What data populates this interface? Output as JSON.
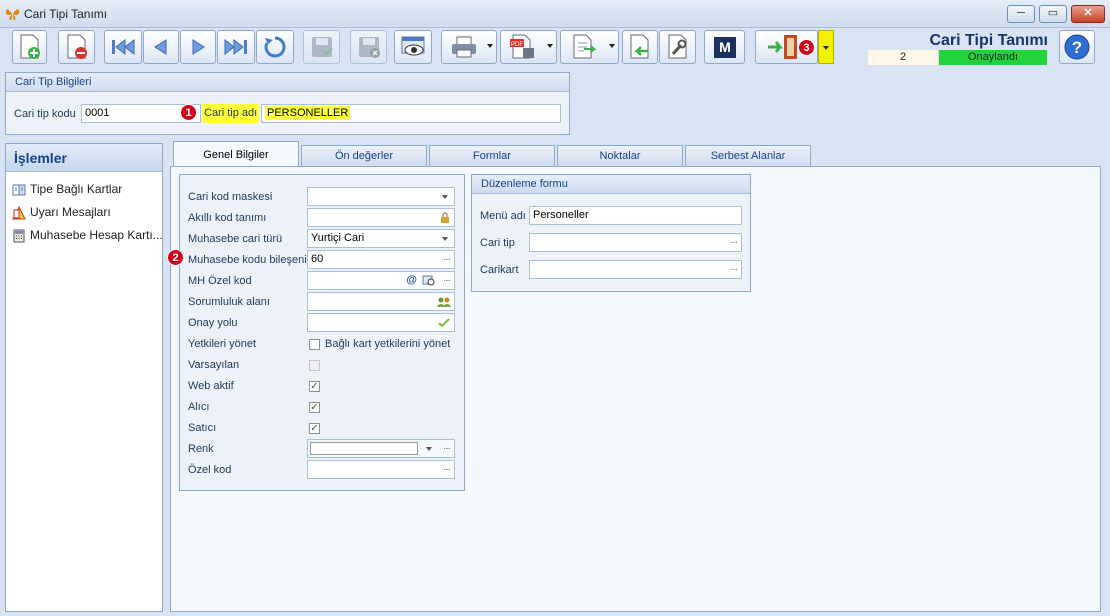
{
  "window": {
    "title": "Cari Tipi Tanımı"
  },
  "header": {
    "title": "Cari Tipi Tanımı",
    "record_no": "2",
    "status": "Onaylandı",
    "status_color": "#22d43c"
  },
  "toolbar": {
    "icons": [
      "new-document-icon",
      "delete-document-icon",
      "first-record-icon",
      "previous-record-icon",
      "next-record-icon",
      "last-record-icon",
      "refresh-icon",
      "save-icon",
      "save-close-icon",
      "preview-icon",
      "print-icon",
      "pdf-export-icon",
      "export-icon",
      "import-icon",
      "settings-icon",
      "m-icon",
      "exit-icon",
      "help-icon"
    ],
    "m_label": "M"
  },
  "markers": {
    "one": "1",
    "two": "2",
    "three": "3"
  },
  "cari_tip_bilgileri": {
    "heading": "Cari Tip Bilgileri",
    "kod_label": "Cari tip kodu",
    "kod_value": "0001",
    "adi_label": "Cari tip adı",
    "adi_value": "PERSONELLER"
  },
  "side": {
    "title": "İşlemler",
    "items": [
      {
        "label": "Tipe Bağlı Kartlar",
        "icon": "linked-cards-icon"
      },
      {
        "label": "Uyarı Mesajları",
        "icon": "warning-messages-icon"
      },
      {
        "label": "Muhasebe Hesap Kartı...",
        "icon": "accounting-card-icon"
      }
    ]
  },
  "tabs": [
    "Genel Bilgiler",
    "Ön değerler",
    "Formlar",
    "Noktalar",
    "Serbest Alanlar"
  ],
  "general": {
    "cari_kod_maskesi": {
      "label": "Cari kod maskesi",
      "value": ""
    },
    "akilli_kod": {
      "label": "Akıllı kod tanımı",
      "value": ""
    },
    "muhasebe_cari_turu": {
      "label": "Muhasebe cari türü",
      "value": "Yurtiçi Cari"
    },
    "muhasebe_kodu_bileseni": {
      "label": "Muhasebe kodu bileşeni",
      "value": "60"
    },
    "mh_ozel_kod": {
      "label": "MH Özel kod",
      "value": ""
    },
    "sorumluluk": {
      "label": "Sorumluluk alanı",
      "value": ""
    },
    "onay_yolu": {
      "label": "Onay yolu",
      "value": ""
    },
    "yetkileri_yonet": {
      "label": "Yetkileri yönet",
      "checkbox_label": "Bağlı kart yetkilerini yönet",
      "checked": false
    },
    "varsayilan": {
      "label": "Varsayılan",
      "checked": false
    },
    "web_aktif": {
      "label": "Web aktif",
      "checked": true
    },
    "alici": {
      "label": "Alıcı",
      "checked": true
    },
    "satici": {
      "label": "Satıcı",
      "checked": true
    },
    "renk": {
      "label": "Renk",
      "value": ""
    },
    "ozel_kod": {
      "label": "Özel kod",
      "value": ""
    }
  },
  "duzenleme": {
    "heading": "Düzenleme formu",
    "menu_adi": {
      "label": "Menü adı",
      "value": "Personeller"
    },
    "cari_tip": {
      "label": "Cari tip",
      "value": ""
    },
    "carikart": {
      "label": "Carikart",
      "value": ""
    }
  }
}
